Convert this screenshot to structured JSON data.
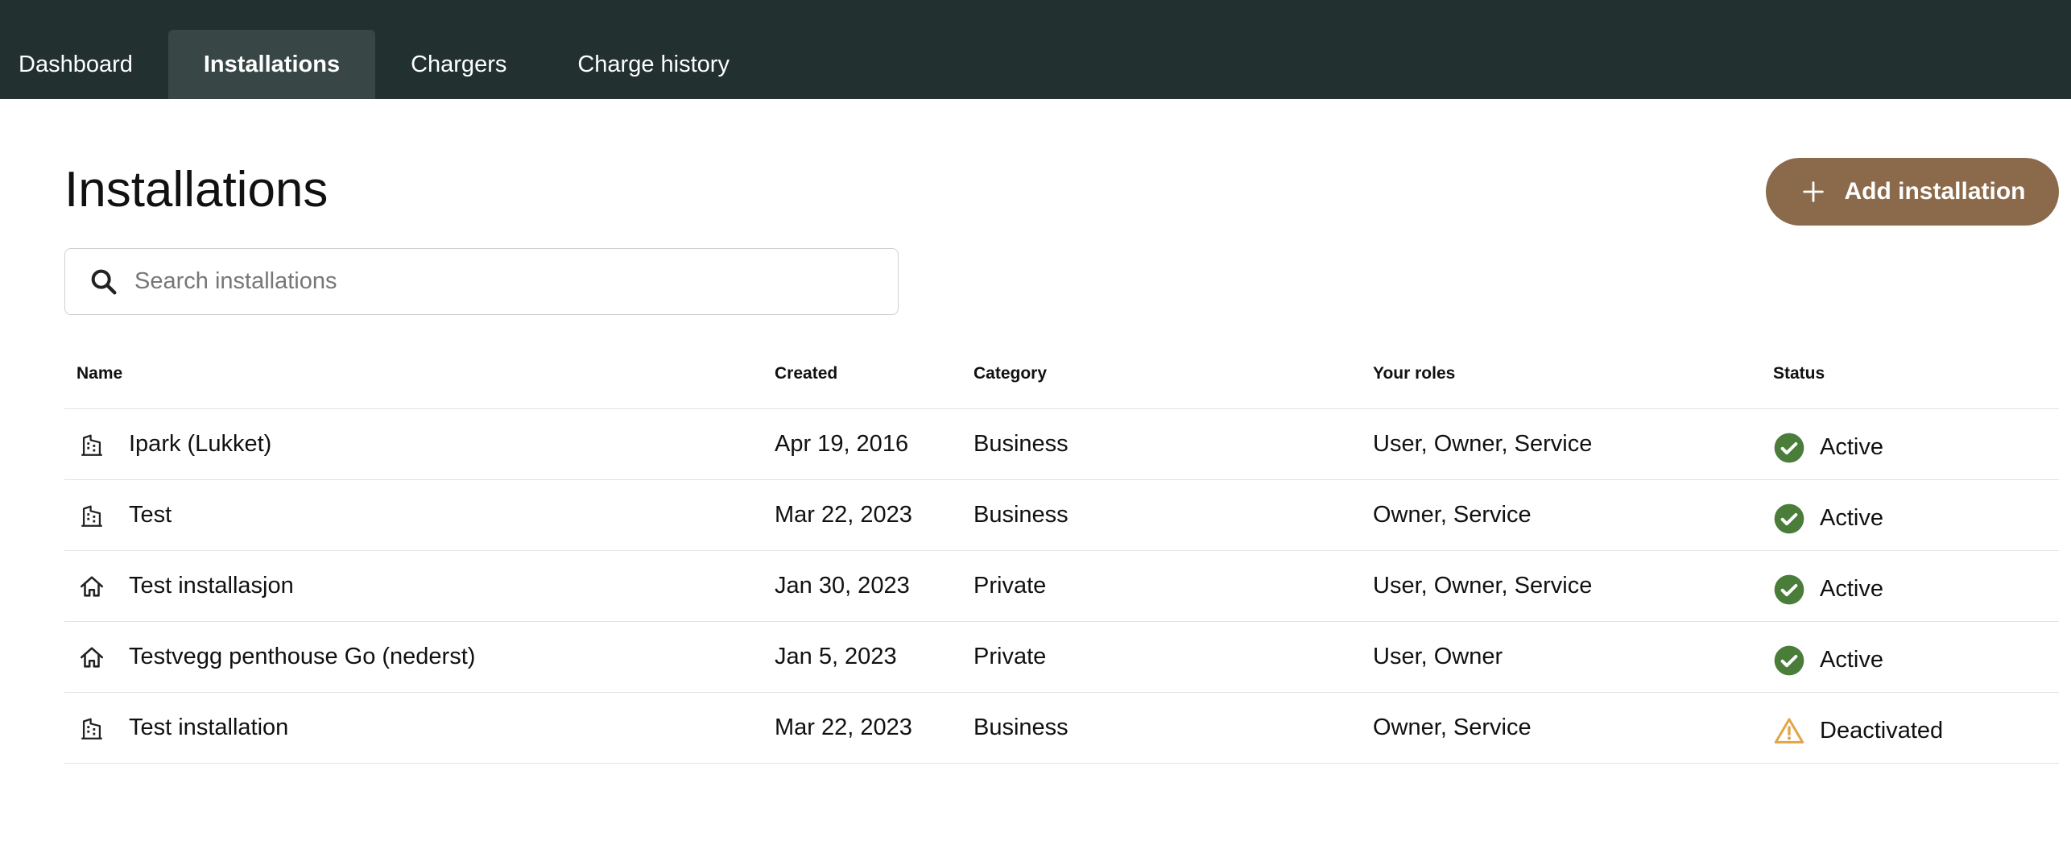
{
  "nav": {
    "tabs": [
      {
        "label": "Dashboard",
        "active": false
      },
      {
        "label": "Installations",
        "active": true
      },
      {
        "label": "Chargers",
        "active": false
      },
      {
        "label": "Charge history",
        "active": false
      }
    ]
  },
  "page": {
    "title": "Installations",
    "add_button_label": "Add installation"
  },
  "search": {
    "placeholder": "Search installations",
    "value": ""
  },
  "table": {
    "columns": [
      "Name",
      "Created",
      "Category",
      "Your roles",
      "Status"
    ],
    "rows": [
      {
        "icon": "building-icon",
        "name": "Ipark (Lukket)",
        "created": "Apr 19, 2016",
        "category": "Business",
        "roles": "User, Owner, Service",
        "status": "Active",
        "status_icon": "check-circle-icon"
      },
      {
        "icon": "building-icon",
        "name": "Test",
        "created": "Mar 22, 2023",
        "category": "Business",
        "roles": "Owner, Service",
        "status": "Active",
        "status_icon": "check-circle-icon"
      },
      {
        "icon": "house-icon",
        "name": "Test installasjon",
        "created": "Jan 30, 2023",
        "category": "Private",
        "roles": "User, Owner, Service",
        "status": "Active",
        "status_icon": "check-circle-icon"
      },
      {
        "icon": "house-icon",
        "name": "Testvegg penthouse Go (nederst)",
        "created": "Jan 5, 2023",
        "category": "Private",
        "roles": "User, Owner",
        "status": "Active",
        "status_icon": "check-circle-icon"
      },
      {
        "icon": "building-icon",
        "name": "Test installation",
        "created": "Mar 22, 2023",
        "category": "Business",
        "roles": "Owner, Service",
        "status": "Deactivated",
        "status_icon": "warning-icon"
      }
    ]
  },
  "colors": {
    "topbar": "#223130",
    "active_tab": "#384745",
    "accent_button": "#8b6a4b",
    "status_active": "#4a7c3a",
    "status_warning": "#e3a347"
  }
}
